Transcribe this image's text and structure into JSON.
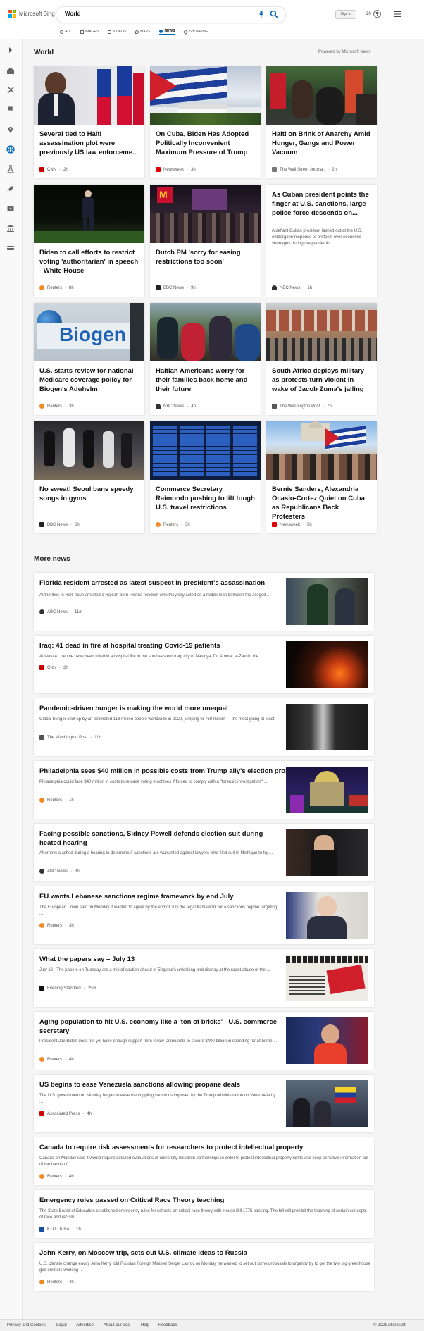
{
  "header": {
    "brand": "Microsoft Bing",
    "search_value": "World",
    "signin_label": "Sign in",
    "rewards_count": "20",
    "brand_colors": [
      "#f25022",
      "#7fba00",
      "#00a4ef",
      "#ffb900"
    ],
    "accent": "#0067b8"
  },
  "tabs": [
    {
      "label": "ALL",
      "icon": "search-icon"
    },
    {
      "label": "IMAGES",
      "icon": "image-icon"
    },
    {
      "label": "VIDEOS",
      "icon": "video-icon"
    },
    {
      "label": "MAPS",
      "icon": "map-icon"
    },
    {
      "label": "NEWS",
      "icon": "news-icon",
      "active": true
    },
    {
      "label": "SHOPPING",
      "icon": "shopping-tag-icon"
    }
  ],
  "rail_icons": [
    "expand-chevron-icon",
    "home-icon",
    "sports-icon",
    "flag-icon",
    "location-icon",
    "globe-icon",
    "science-icon",
    "rocket-icon",
    "video-icon",
    "building-icon",
    "money-icon"
  ],
  "world": {
    "title": "World",
    "powered_by": "Powered by Microsoft News"
  },
  "cards": [
    {
      "title": "Several tied to Haiti assassination plot were previously US law enforceme...",
      "source": "CNN",
      "time": "2h",
      "src_color": "#cc0000"
    },
    {
      "title": "On Cuba, Biden Has Adopted Politically Inconvenient Maximum Pressure of Trump",
      "source": "Newsweek",
      "time": "3h",
      "src_color": "#e00000"
    },
    {
      "title": "Haiti on Brink of Anarchy Amid Hunger, Gangs and Power Vacuum",
      "source": "The Wall Street Journal.",
      "time": "2h",
      "src_color": "#777777"
    },
    {
      "title": "Biden to call efforts to restrict voting 'authoritarian' in speech - White House",
      "source": "Reuters",
      "time": "8h",
      "src_color": "#f08a24"
    },
    {
      "title": "Dutch PM 'sorry for easing restrictions too soon'",
      "source": "BBC News",
      "time": "9h",
      "src_color": "#222222"
    },
    {
      "title": "As Cuban president points the finger at U.S. sanctions, large police force descends on...",
      "snippet": "A defiant Cuban president lashed out at the U.S. embargo in response to protests over economic shortages during the pandemic.",
      "source": "NBC News",
      "time": "1h",
      "src_color": "#333333"
    },
    {
      "title": "U.S. starts review for national Medicare coverage policy for Biogen's Aduhelm",
      "source": "Reuters",
      "time": "3h",
      "src_color": "#f08a24",
      "image_text": "Biogen"
    },
    {
      "title": "Haitian Americans worry for their families back home and their future",
      "source": "NBC News",
      "time": "4h",
      "src_color": "#333333"
    },
    {
      "title": "South Africa deploys military as protests turn violent in wake of Jacob Zuma's jailing",
      "source": "The Washington Post",
      "time": "7h",
      "src_color": "#555555"
    },
    {
      "title": "No sweat! Seoul bans speedy songs in gyms",
      "source": "BBC News",
      "time": "6h",
      "src_color": "#222222"
    },
    {
      "title": "Commerce Secretary Raimondo pushing to lift tough U.S. travel restrictions",
      "source": "Reuters",
      "time": "3h",
      "src_color": "#f08a24"
    },
    {
      "title": "Bernie Sanders, Alexandria Ocasio-Cortez Quiet on Cuba as Republicans Back Protesters",
      "source": "Newsweek",
      "time": "5h",
      "src_color": "#e00000"
    }
  ],
  "more_news": {
    "title": "More news",
    "items": [
      {
        "title": "Florida resident arrested as latest suspect in president's assassination",
        "snippet": "Authorities in Haiti have arrested a Haitian-born Florida resident who they say acted as a middleman between the alleged ...",
        "source": "ABC News",
        "time": "11m",
        "src_color": "#333333"
      },
      {
        "title": "Iraq: 41 dead in fire at hospital treating Covid-19 patients",
        "snippet": "At least 41 people have been killed in a hospital fire in the southeastern Iraqi city of Nasiriya, Dr. Ammar al-Zamili, the ...",
        "source": "CNN",
        "time": "2h",
        "src_color": "#cc0000"
      },
      {
        "title": "Pandemic-driven hunger is making the world more unequal",
        "snippet": "Global hunger shot up by an estimated 118 million people worldwide in 2020, jumping to 768 million — the most going at least ...",
        "source": "The Washington Post",
        "time": "11h",
        "src_color": "#555555"
      },
      {
        "title": "Philadelphia sees $40 million in possible costs from Trump ally's election probe",
        "snippet": "Philadelphia could face $40 million in costs to replace voting machines if forced to comply with a \"forensic investigation\" ...",
        "source": "Reuters",
        "time": "1h",
        "src_color": "#f08a24"
      },
      {
        "title": "Facing possible sanctions, Sidney Powell defends election suit during heated hearing",
        "snippet": "Attorneys clashed during a hearing to determine if sanctions are warranted against lawyers who filed suit in Michigan to try ...",
        "source": "ABC News",
        "time": "3h",
        "src_color": "#333333"
      },
      {
        "title": "EU wants Lebanese sanctions regime framework by end July",
        "snippet": "The European Union said on Monday it wanted to agree by the end of July the legal framework for a sanctions regime targeting ...",
        "source": "Reuters",
        "time": "3h",
        "src_color": "#f08a24"
      },
      {
        "title": "What the papers say – July 13",
        "snippet": "July 13 - The papers on Tuesday are a mix of caution ahead of England's unlocking and dismay at the racist abuse of the ...",
        "source": "Evening Standard",
        "time": "25m",
        "src_color": "#111111"
      },
      {
        "title": "Aging population to hit U.S. economy like a 'ton of bricks' - U.S. commerce secretary",
        "snippet": "President Joe Biden does not yet have enough support from fellow Democrats to secure $400 billion in spending for at-home ...",
        "source": "Reuters",
        "time": "4h",
        "src_color": "#f08a24"
      },
      {
        "title": "US begins to ease Venezuela sanctions allowing propane deals",
        "snippet": "The U.S. government on Monday began to ease the crippling sanctions imposed by the Trump administration on Venezuela by ...",
        "source": "Associated Press",
        "time": "4h",
        "src_color": "#d00000"
      },
      {
        "title": "Canada to require risk assessments for researchers to protect intellectual property",
        "snippet": "Canada on Monday said it would require detailed evaluations of university research partnerships in order to protect intellectual property rights and keep sensitive information out of the hands of ...",
        "source": "Reuters",
        "time": "4h",
        "src_color": "#f08a24"
      },
      {
        "title": "Emergency rules passed on Critical Race Theory teaching",
        "snippet": "The State Board of Education established emergency rules for schools on critical race theory with House Bill 1775 passing. The bill will prohibit the teaching of certain concepts of race and racism ...",
        "source": "KTUL Tulsa",
        "time": "1h",
        "src_color": "#1a4fa0"
      },
      {
        "title": "John Kerry, on Moscow trip, sets out U.S. climate ideas to Russia",
        "snippet": "U.S. climate change envoy John Kerry told Russian Foreign Minister Sergei Lavrov on Monday he wanted to set out some proposals to urgently try to get the two big greenhouse gas emitters working ...",
        "source": "Reuters",
        "time": "4h",
        "src_color": "#f08a24"
      }
    ]
  },
  "footer": {
    "links": [
      "Privacy and Cookies",
      "Legal",
      "Advertise",
      "About our ads",
      "Help",
      "Feedback"
    ],
    "copyright": "© 2021 Microsoft"
  }
}
